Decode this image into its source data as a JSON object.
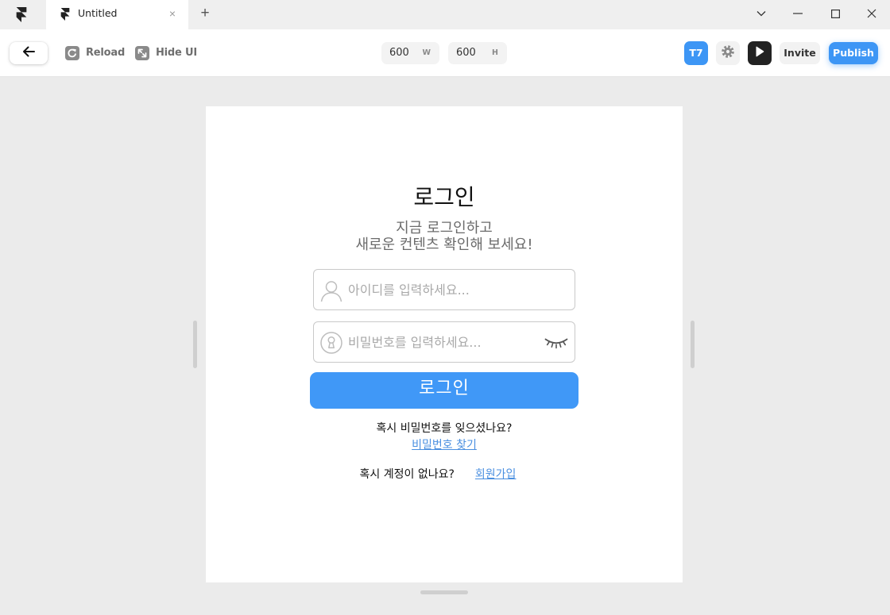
{
  "app": {
    "logo_icon": "framer-logo-icon",
    "tab_title": "Untitled",
    "tab_close": "×",
    "new_tab": "+"
  },
  "window_controls": {
    "collapse_icon": "chevron-down-icon",
    "minimize_icon": "minimize-icon",
    "maximize_icon": "maximize-icon",
    "close_icon": "close-icon"
  },
  "toolbar": {
    "back_icon": "arrow-left-icon",
    "reload_icon": "reload-icon",
    "reload_label": "Reload",
    "hide_ui_icon": "expand-icon",
    "hide_ui_label": "Hide UI",
    "width": {
      "value": "600",
      "unit": "W"
    },
    "height": {
      "value": "600",
      "unit": "H"
    },
    "avatar_label": "T7",
    "settings_icon": "gear-icon",
    "preview_icon": "play-icon",
    "invite_label": "Invite",
    "publish_label": "Publish"
  },
  "login_page": {
    "title": "로그인",
    "subtitle_line1": "지금 로그인하고",
    "subtitle_line2": "새로운 컨텐츠 확인해 보세요!",
    "id_field": {
      "icon": "user-icon",
      "value": "",
      "placeholder": "아이디를 입력하세요..."
    },
    "password_field": {
      "icon": "keyhole-icon",
      "value": "",
      "placeholder": "비밀번호를 입력하세요...",
      "toggle_icon": "eye-closed-icon"
    },
    "login_button": "로그인",
    "forgot_prompt": "혹시 비밀번호를 잊으셨나요?",
    "forgot_link": "비밀번호 찾기",
    "signup_prompt": "혹시 계정이 없나요?",
    "signup_link": "회원가입"
  },
  "colors": {
    "accent": "#3d96f5",
    "login_button": "#4098f7",
    "link": "#4a8fe0",
    "preview_button": "#222222",
    "canvas_background": "#ebebeb"
  }
}
